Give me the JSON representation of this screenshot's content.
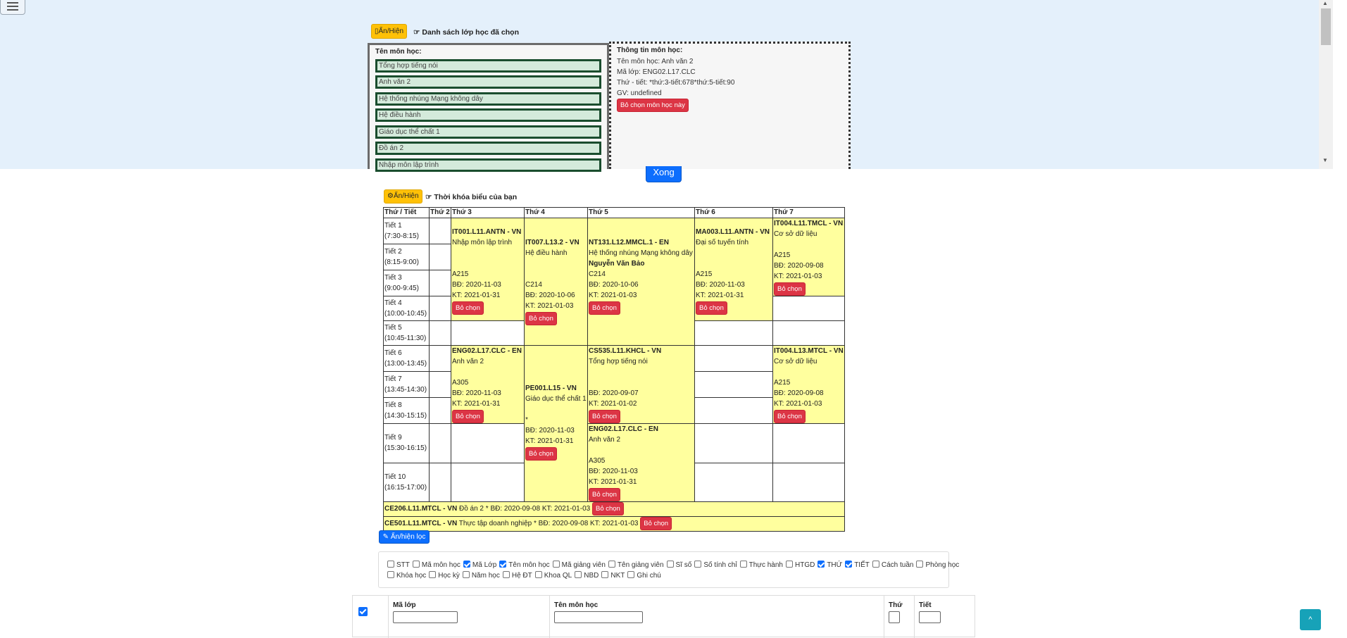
{
  "top": {
    "toggle_label": "Ẩn/Hiện",
    "selected_title": "Danh sách lớp học đã chọn",
    "subject_list_label": "Tên môn học:",
    "subjects": [
      "Tổng hợp tiếng nói",
      "Anh văn 2",
      "Hệ thống nhúng Mạng không dây",
      "Hệ điều hành",
      "Giáo dục thể chất 1",
      "Đồ án 2",
      "Nhập môn lập trình"
    ],
    "info_label": "Thông tin môn học:",
    "info_lines": [
      "Tên môn học: Anh văn 2",
      "Mã lớp: ENG02.L17.CLC",
      "Thứ - tiết: *thứ:3-tiết:678*thứ:5-tiết:90",
      "GV: undefined"
    ],
    "remove_subject_label": "Bỏ chọn môn học này",
    "done_label": "Xong"
  },
  "schedule": {
    "toggle_label": "Ẩn/Hiện",
    "title": "Thời khóa biểu của bạn",
    "headers": [
      "Thứ / Tiết",
      "Thứ 2",
      "Thứ 3",
      "Thứ 4",
      "Thứ 5",
      "Thứ 6",
      "Thứ 7"
    ],
    "periods": [
      {
        "name": "Tiết 1",
        "time": "(7:30-8:15)"
      },
      {
        "name": "Tiết 2",
        "time": "(8:15-9:00)"
      },
      {
        "name": "Tiết 3",
        "time": "(9:00-9:45)"
      },
      {
        "name": "Tiết 4",
        "time": "(10:00-10:45)"
      },
      {
        "name": "Tiết 5",
        "time": "(10:45-11:30)"
      },
      {
        "name": "Tiết 6",
        "time": "(13:00-13:45)"
      },
      {
        "name": "Tiết 7",
        "time": "(13:45-14:30)"
      },
      {
        "name": "Tiết 8",
        "time": "(14:30-15:15)"
      },
      {
        "name": "Tiết 9",
        "time": "(15:30-16:15)"
      },
      {
        "name": "Tiết 10",
        "time": "(16:15-17:00)"
      }
    ],
    "remove_label": "Bỏ chọn",
    "classes": {
      "it001": {
        "code": "IT001.L11.ANTN - VN",
        "name": "Nhập môn lập trình",
        "room": "A215",
        "start": "BĐ: 2020-11-03",
        "end": "KT: 2021-01-31"
      },
      "it007": {
        "code": "IT007.L13.2 - VN",
        "name": "Hệ điều hành",
        "room": "C214",
        "start": "BĐ: 2020-10-06",
        "end": "KT: 2021-01-03"
      },
      "nt131": {
        "code": "NT131.L12.MMCL.1 - EN",
        "name": "Hệ thống nhúng Mạng không dây",
        "teacher": "Nguyễn Văn Bảo",
        "room": "C214",
        "start": "BĐ: 2020-10-06",
        "end": "KT: 2021-01-03"
      },
      "ma003": {
        "code": "MA003.L11.ANTN - VN",
        "name": "Đại số tuyến tính",
        "room": "A215",
        "start": "BĐ: 2020-11-03",
        "end": "KT: 2021-01-31"
      },
      "it004a": {
        "code": "IT004.L11.TMCL - VN",
        "name": "Cơ sở dữ liệu",
        "room": "A215",
        "start": "BĐ: 2020-09-08",
        "end": "KT: 2021-01-03"
      },
      "eng02a": {
        "code": "ENG02.L17.CLC - EN",
        "name": "Anh văn 2",
        "room": "A305",
        "start": "BĐ: 2020-11-03",
        "end": "KT: 2021-01-31"
      },
      "pe001": {
        "code": "PE001.L15 - VN",
        "name": "Giáo dục thể chất 1",
        "room": "*",
        "start": "BĐ: 2020-11-03",
        "end": "KT: 2021-01-31"
      },
      "cs535": {
        "code": "CS535.L11.KHCL - VN",
        "name": "Tổng hợp tiếng nói",
        "start": "BĐ: 2020-09-07",
        "end": "KT: 2021-01-02"
      },
      "it004b": {
        "code": "IT004.L13.MTCL - VN",
        "name": "Cơ sở dữ liệu",
        "room": "A215",
        "start": "BĐ: 2020-09-08",
        "end": "KT: 2021-01-03"
      },
      "eng02b": {
        "code": "ENG02.L17.CLC - EN",
        "name": "Anh văn 2",
        "room": "A305",
        "start": "BĐ: 2020-11-03",
        "end": "KT: 2021-01-31"
      }
    },
    "extra_rows": [
      {
        "code": "CE206.L11.MTCL - VN",
        "detail": "Đồ án 2 * BĐ: 2020-09-08 KT: 2021-01-03"
      },
      {
        "code": "CE501.L11.MTCL - VN",
        "detail": "Thực tập doanh nghiệp * BĐ: 2020-09-08 KT: 2021-01-03"
      }
    ]
  },
  "filter": {
    "toggle_label": "Ẩn/hiện lọc",
    "row1": [
      {
        "label": "STT",
        "checked": false
      },
      {
        "label": "Mã môn học",
        "checked": false
      },
      {
        "label": "Mã Lớp",
        "checked": true
      },
      {
        "label": "Tên môn học",
        "checked": true
      },
      {
        "label": "Mã giảng viên",
        "checked": false
      },
      {
        "label": "Tên giảng viên",
        "checked": false
      },
      {
        "label": "Sĩ số",
        "checked": false
      },
      {
        "label": "Số tính chỉ",
        "checked": false
      },
      {
        "label": "Thực hành",
        "checked": false
      },
      {
        "label": "HTGD",
        "checked": false
      },
      {
        "label": "THỨ",
        "checked": true
      },
      {
        "label": "TIẾT",
        "checked": true
      },
      {
        "label": "Cách tuần",
        "checked": false
      },
      {
        "label": "Phòng học",
        "checked": false
      }
    ],
    "row2": [
      {
        "label": "Khóa học",
        "checked": false
      },
      {
        "label": "Học kỳ",
        "checked": false
      },
      {
        "label": "Năm học",
        "checked": false
      },
      {
        "label": "Hệ ĐT",
        "checked": false
      },
      {
        "label": "Khoa QL",
        "checked": false
      },
      {
        "label": "NBD",
        "checked": false
      },
      {
        "label": "NKT",
        "checked": false
      },
      {
        "label": "Ghi chú",
        "checked": false
      }
    ]
  },
  "table": {
    "col_class": "Mã lớp",
    "col_subject": "Tên môn học",
    "col_day": "Thứ",
    "col_period": "Tiết"
  },
  "scroll_top_label": "^",
  "colors": {
    "panel_bg": "#e4f0fb",
    "schedule_fill": "#ffff9e",
    "danger": "#dc3545",
    "warning": "#ffc107",
    "primary": "#0d6efd",
    "subject_border": "#1a4d2e"
  }
}
